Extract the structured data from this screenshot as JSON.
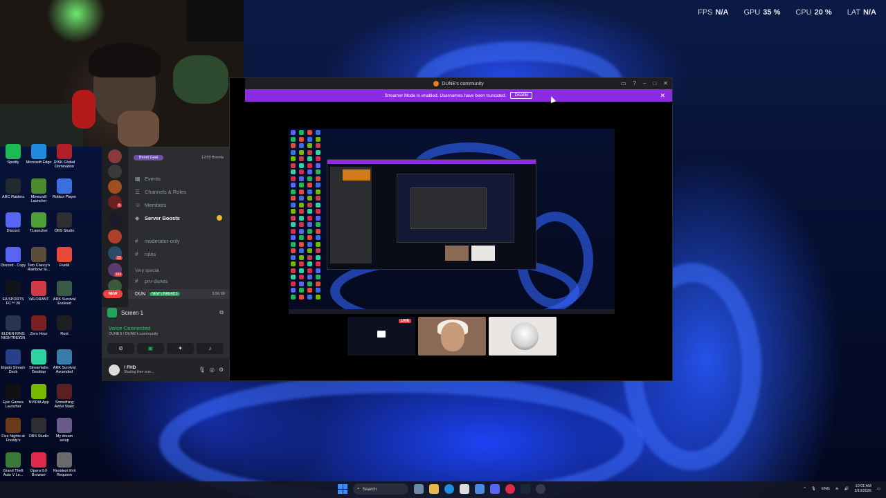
{
  "hud": {
    "fps_label": "FPS",
    "fps_value": "N/A",
    "gpu_label": "GPU",
    "gpu_value": "35 %",
    "cpu_label": "CPU",
    "cpu_value": "20 %",
    "lat_label": "LAT",
    "lat_value": "N/A"
  },
  "desktop_icons": [
    {
      "label": "Spotify",
      "color": "#1db954"
    },
    {
      "label": "Microsoft Edge",
      "color": "#1e8be0"
    },
    {
      "label": "RISK Global Domination",
      "color": "#b0202a"
    },
    {
      "label": "ARC Raiders",
      "color": "#222a30"
    },
    {
      "label": "Minecraft Launcher",
      "color": "#4b8a2f"
    },
    {
      "label": "Roblox Player",
      "color": "#3b6fe0"
    },
    {
      "label": "Discord",
      "color": "#5865f2"
    },
    {
      "label": "TLauncher",
      "color": "#4f9e3a"
    },
    {
      "label": "OBS Studio",
      "color": "#2e2e33"
    },
    {
      "label": "Discord - Copy",
      "color": "#5865f2"
    },
    {
      "label": "Tom Clancy's Rainbow Si...",
      "color": "#5a4b3a"
    },
    {
      "label": "FiveM",
      "color": "#e84a3a"
    },
    {
      "label": "EA SPORTS FC™ 26",
      "color": "#111418"
    },
    {
      "label": "VALORANT",
      "color": "#d13a46"
    },
    {
      "label": "ARK Survival Evolved",
      "color": "#3a5a48"
    },
    {
      "label": "ELDEN RING NIGHTREIGN",
      "color": "#2a3650"
    },
    {
      "label": "Zero Hour",
      "color": "#7a2020"
    },
    {
      "label": "Root",
      "color": "#1e1e1e"
    },
    {
      "label": "Elgato Stream Deck",
      "color": "#2a3f8a"
    },
    {
      "label": "Streamlabs Desktop",
      "color": "#2fd3a0"
    },
    {
      "label": "ARK Survival Ascended",
      "color": "#3a7aa8"
    },
    {
      "label": "Epic Games Launcher",
      "color": "#111111"
    },
    {
      "label": "NVIDIA App",
      "color": "#76b900"
    },
    {
      "label": "Something Awful Static",
      "color": "#5a2020"
    },
    {
      "label": "Five Nights at Freddy's",
      "color": "#6a3a1a"
    },
    {
      "label": "OBS Studio",
      "color": "#2e2e33"
    },
    {
      "label": "My dream setup",
      "color": "#6a5a8a"
    },
    {
      "label": "Grand Theft Auto V Le...",
      "color": "#3a7a3a"
    },
    {
      "label": "Opera GX Browser",
      "color": "#e0284a"
    },
    {
      "label": "Resident Evil Requiem",
      "color": "#6a6a6a"
    }
  ],
  "guild_badges": [
    "5",
    "23",
    "163"
  ],
  "sidebar": {
    "boost_goal": "Boost Goal",
    "boost_count": "12/33 Boosts",
    "items": [
      {
        "label": "Events",
        "icon": "calendar-icon"
      },
      {
        "label": "Channels & Roles",
        "icon": "list-icon"
      },
      {
        "label": "Members",
        "icon": "members-icon"
      },
      {
        "label": "Server Boosts",
        "icon": "boost-icon"
      }
    ],
    "channels": [
      {
        "label": "moderator-only"
      },
      {
        "label": "rules"
      }
    ],
    "category": "Very special",
    "channel_prv": "prv-dunes",
    "new_badge": "NEW",
    "unread_channel": "DUN",
    "new_unreads": "NEW UNREADS",
    "unread_time": "5:56:09"
  },
  "voice": {
    "screen_label": "Screen 1",
    "status": "Voice Connected",
    "location": "DUNES / DUNE's community"
  },
  "user": {
    "name": "! FHD",
    "status": "Sharing their scre..."
  },
  "window": {
    "title": "DUNE's community",
    "streamer_text": "Streamer Mode is enabled. Usernames have been truncated.",
    "disable_label": "Disable",
    "live_label": "LIVE"
  },
  "taskbar": {
    "search_placeholder": "Search",
    "lang": "ENG",
    "time": "10:01 AM",
    "date": "3/10/2026"
  }
}
